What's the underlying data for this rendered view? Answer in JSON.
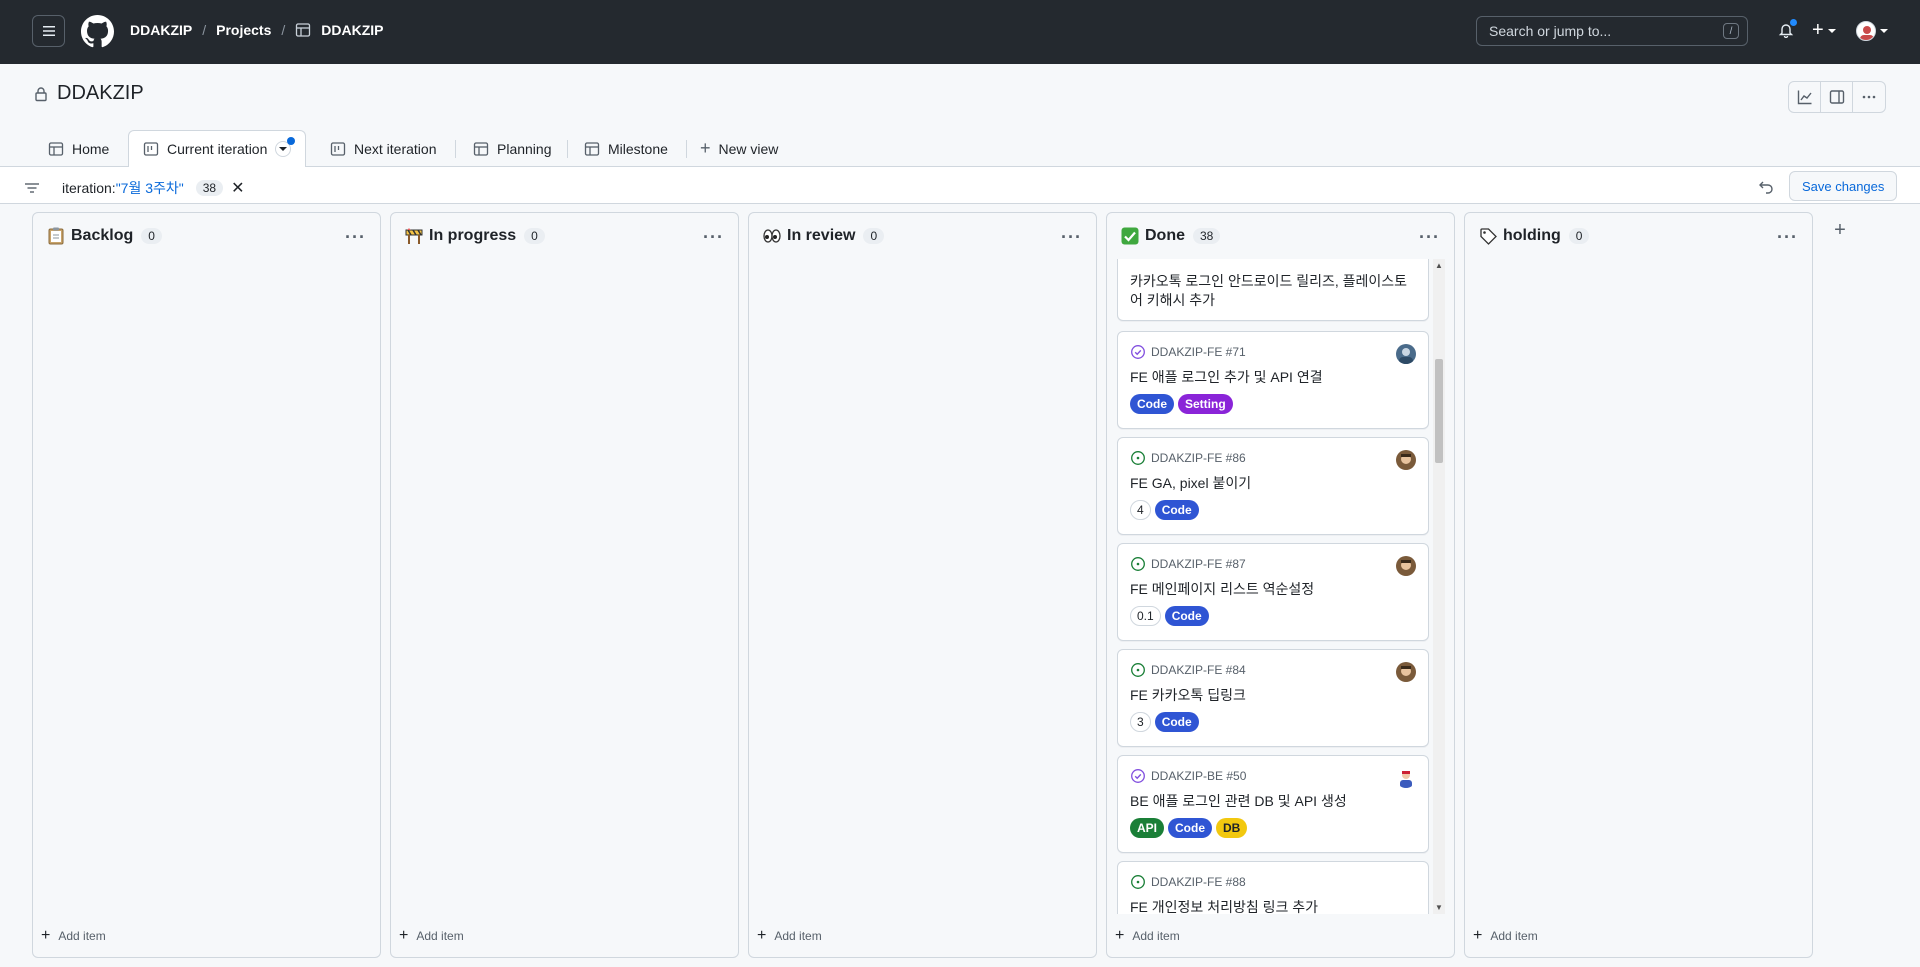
{
  "header": {
    "owner": "DDAKZIP",
    "projects": "Projects",
    "project": "DDAKZIP",
    "search_placeholder": "Search or jump to...",
    "search_shortcut": "/"
  },
  "project": {
    "title": "DDAKZIP"
  },
  "tabs": [
    {
      "label": "Home",
      "icon": "table-icon"
    },
    {
      "label": "Current iteration",
      "icon": "board-icon",
      "active": true
    },
    {
      "label": "Next iteration",
      "icon": "board-icon"
    },
    {
      "label": "Planning",
      "icon": "table-icon"
    },
    {
      "label": "Milestone",
      "icon": "table-icon"
    },
    {
      "label": "New view",
      "icon": "plus-icon"
    }
  ],
  "filter": {
    "prefix": "iteration:",
    "value": "\"7월 3주차\"",
    "count": "38",
    "save_label": "Save changes"
  },
  "columns": [
    {
      "name": "Backlog",
      "count": "0",
      "emoji": "clipboard-icon",
      "add": "Add item"
    },
    {
      "name": "In progress",
      "count": "0",
      "emoji": "construction-icon",
      "add": "Add item"
    },
    {
      "name": "In review",
      "count": "0",
      "emoji": "eyes-icon",
      "add": "Add item"
    },
    {
      "name": "Done",
      "count": "38",
      "emoji": "check-mark-icon",
      "add": "Add item"
    },
    {
      "name": "holding",
      "count": "0",
      "emoji": "label-icon",
      "add": "Add item"
    }
  ],
  "done_cards": [
    {
      "ref": "",
      "title": "카카오톡 로그인 안드로이드 릴리즈, 플레이스토어 키해시 추가",
      "status": "partial",
      "labels": []
    },
    {
      "ref": "DDAKZIP-FE #71",
      "title": "FE 애플 로그인 추가 및 API 연결",
      "status": "closed",
      "estimate": "",
      "labels": [
        {
          "name": "Code",
          "color": "#2f55d4"
        },
        {
          "name": "Setting",
          "color": "#8a24d8"
        }
      ]
    },
    {
      "ref": "DDAKZIP-FE #86",
      "title": "FE GA, pixel 붙이기",
      "status": "open",
      "estimate": "4",
      "labels": [
        {
          "name": "Code",
          "color": "#2f55d4"
        }
      ]
    },
    {
      "ref": "DDAKZIP-FE #87",
      "title": "FE 메인페이지 리스트 역순설정",
      "status": "open",
      "estimate": "0.1",
      "labels": [
        {
          "name": "Code",
          "color": "#2f55d4"
        }
      ]
    },
    {
      "ref": "DDAKZIP-FE #84",
      "title": "FE 카카오톡 딥링크",
      "status": "open",
      "estimate": "3",
      "labels": [
        {
          "name": "Code",
          "color": "#2f55d4"
        }
      ]
    },
    {
      "ref": "DDAKZIP-BE #50",
      "title": "BE 애플 로그인 관련 DB 및 API 생성",
      "status": "closed",
      "estimate": "",
      "labels": [
        {
          "name": "API",
          "color": "#1a7f37"
        },
        {
          "name": "Code",
          "color": "#2f55d4"
        },
        {
          "name": "DB",
          "color": "#f2c80f",
          "text": "#1f2328"
        }
      ]
    },
    {
      "ref": "DDAKZIP-FE #88",
      "title": "FE 개인정보 처리방침 링크 추가",
      "status": "open",
      "estimate": "",
      "labels": []
    }
  ],
  "colors": {
    "header_bg": "#24292f",
    "accent": "#0969da",
    "open_green": "#1a7f37",
    "closed_purple": "#8250df"
  }
}
